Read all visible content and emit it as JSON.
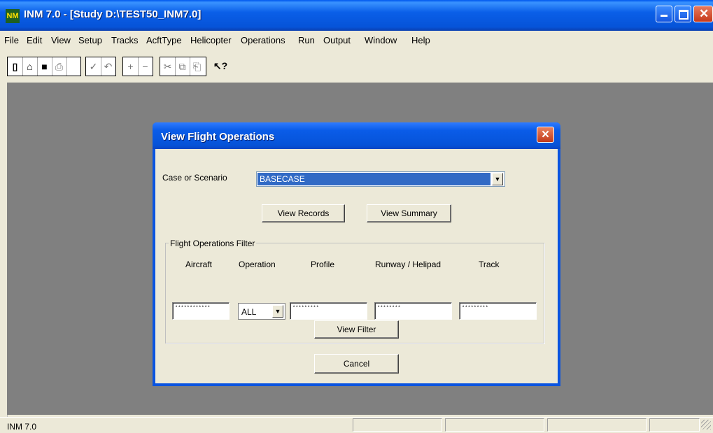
{
  "app": {
    "title": "INM 7.0  - [Study D:\\TEST50_INM7.0]",
    "icon_text": "NM",
    "status_text": "INM 7.0"
  },
  "menu": [
    "File",
    "Edit",
    "View",
    "Setup",
    "Tracks",
    "AcftType",
    "Helicopter",
    "Operations",
    "Run",
    "Output",
    "Window",
    "Help"
  ],
  "toolbar_icons": [
    "new-icon",
    "open-icon",
    "save-icon",
    "print-icon",
    "check-icon",
    "undo-icon",
    "add-icon",
    "remove-icon",
    "cut-icon",
    "copy-icon",
    "paste-icon",
    "context-help-icon"
  ],
  "dialog": {
    "title": "View Flight Operations",
    "case_label": "Case or Scenario",
    "case_value": "BASECASE",
    "view_records": "View Records",
    "view_summary": "View Summary",
    "filter_group": "Flight Operations Filter",
    "headers": {
      "aircraft": "Aircraft",
      "operation": "Operation",
      "profile": "Profile",
      "runway": "Runway / Helipad",
      "track": "Track"
    },
    "values": {
      "aircraft": "************",
      "operation": "ALL",
      "profile": "*********",
      "runway": "********",
      "track": "*********"
    },
    "view_filter": "View Filter",
    "cancel": "Cancel"
  },
  "colors": {
    "titlebar": "#0653d8",
    "mdi_background": "#808080",
    "selection": "#316ac5",
    "face": "#ece9d8"
  }
}
